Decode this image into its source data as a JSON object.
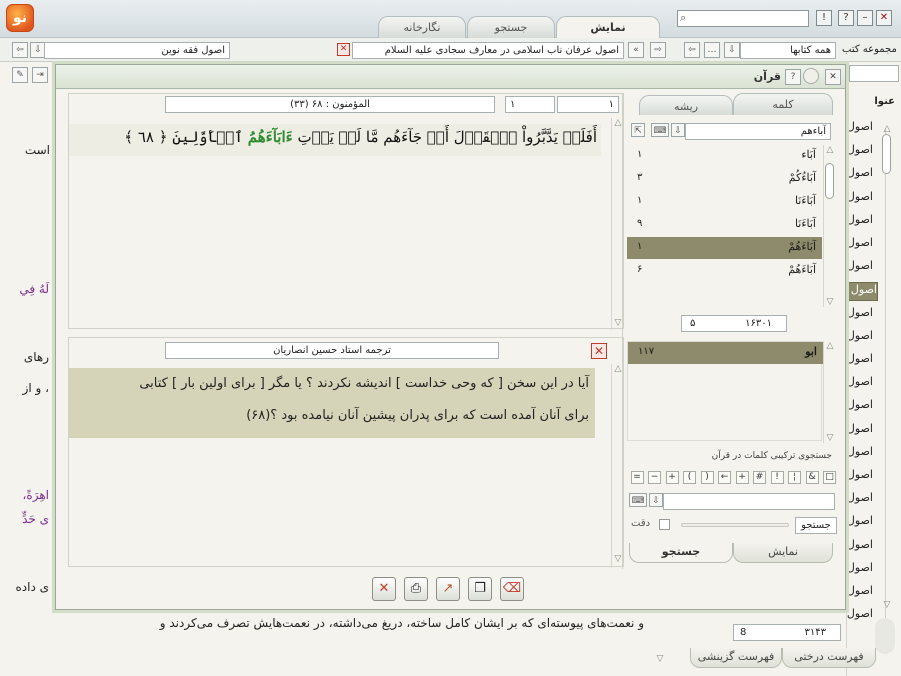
{
  "app": {
    "logo_text": "نو",
    "tabs": [
      {
        "label": "نمایش",
        "active": true
      },
      {
        "label": "جستجو",
        "active": false
      },
      {
        "label": "نگارخانه",
        "active": false
      }
    ],
    "window_buttons": {
      "close": "✕",
      "minimize": "–",
      "help": "?",
      "info": "!"
    }
  },
  "address_bar": {
    "book_title": "اصول عرفان ناب اسلامی در معارف سجادی علیه السلام",
    "book2_title": "اصول فقه نوین",
    "collection_value": "همه کتابها",
    "collection_label": "مجموعه کتب"
  },
  "background_text": {
    "line1": "است",
    "line2": "لَهُ فِي",
    "line3": "رهای",
    "line4": "، و از",
    "line5": "اهِرَةً،",
    "line6": "ى حَدٍّ",
    "line7": "ی داده",
    "line8": "و نعمت‌های پیوسته‌ای که بر ایشان کامل ساخته، دریغ می‌داشته، در نعمت‌هایش تصرف می‌کردند و"
  },
  "right_panel": {
    "header": "عنوا",
    "items": [
      "اصول",
      "اصول",
      "اصول",
      "اصول",
      "اصول",
      "اصول",
      "اصول",
      "اصول",
      "اصول",
      "اصول",
      "اصول",
      "اصول",
      "اصول",
      "اصول",
      "اصول",
      "اصول",
      "اصول",
      "اصول",
      "اصول",
      "اصول",
      "اصول",
      "اصول"
    ],
    "selected_index": 7,
    "page_current": "8",
    "page_total": "۳۱۴۳",
    "bottom_tabs": [
      "فهرست درختی",
      "فهرست گزینشی"
    ]
  },
  "dialog": {
    "title": "قرآن",
    "verse_ref": "(۳۳) المؤمنون : ۶۸",
    "nav_a": "۱",
    "nav_b": "۱",
    "verse_text_start": "أَفَلَمۡ يَدَّبَّرُواْ ٱلۡقَوۡلَ أَمۡ جَآءَهُم مَّا لَمۡ يَأۡتِ ",
    "verse_text_highlight": "ءَابَآءَهُمُ",
    "verse_text_end": " ٱلۡأَوَّلِينَ ﴿ ٦٨ ﴾",
    "translator": "ترجمه استاد حسین انصاریان",
    "translation_line1": "آیا در این سخن [ که وحی خداست ] اندیشه نکردند ؟ یا مگر [ برای اولین بار ] کتابی",
    "translation_line2": "برای آنان آمده است که برای پدران پیشین آنان نیامده بود ؟(۶۸)",
    "side": {
      "tabs": [
        {
          "label": "کلمه",
          "active": true
        },
        {
          "label": "ریشه",
          "active": false
        }
      ],
      "search_value": "آباءهم",
      "words": [
        {
          "word": "آبَاء",
          "count": "۱"
        },
        {
          "word": "آبَاءُکُمْ",
          "count": "۳"
        },
        {
          "word": "آبَاءَنَا",
          "count": "۱"
        },
        {
          "word": "آبَاءَنَا",
          "count": "۹"
        },
        {
          "word": "آبَاءَهُمْ",
          "count": "۱"
        },
        {
          "word": "آبَاءَهُمْ",
          "count": "۶"
        }
      ],
      "selected_index": 4,
      "page_total": "۱۶۳۰۱",
      "page_current": "۵",
      "root_word": "ابو",
      "root_count": "۱۱۷",
      "combo_label": "جستجوی ترکیبی کلمات در قرآن",
      "operators": [
        "□",
        "&",
        "¦",
        "!",
        "#",
        "+",
        "←",
        ")",
        "(",
        "+",
        "−",
        "="
      ],
      "search_button": "جستجو",
      "exact_label": "دقت",
      "bottom_tabs": [
        {
          "label": "نمایش",
          "active": false
        },
        {
          "label": "جستجو",
          "active": true
        }
      ]
    },
    "toolbar": [
      "close-tool-icon",
      "print-icon",
      "export-icon",
      "copy-icon",
      "delete-tool-icon"
    ]
  },
  "colors": {
    "highlight_green": "#2e8b2e",
    "selection": "#8e8b6c",
    "pane_highlight": "#d5d4b8",
    "red_accent": "#c43a2b"
  }
}
